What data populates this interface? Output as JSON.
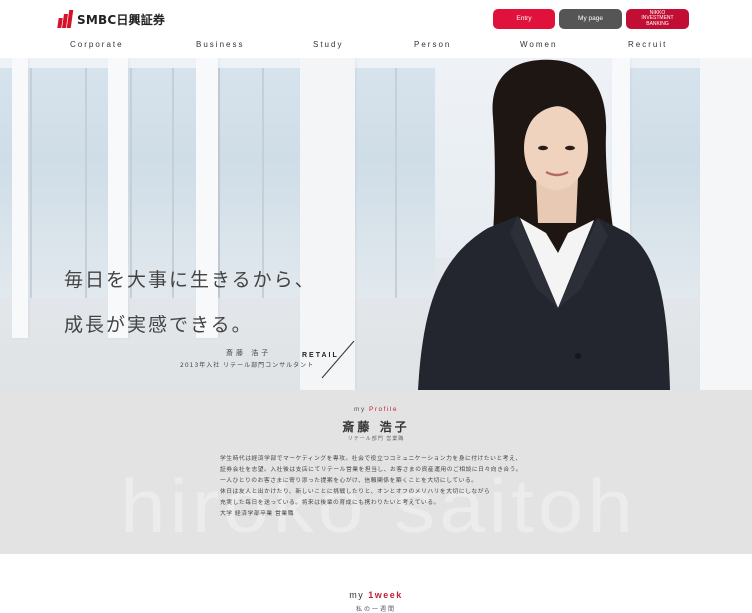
{
  "header": {
    "logo_text": "SMBC日興証券",
    "entry_label": "Entry",
    "mypage_label": "My page",
    "nikko_label": "NIKKO\nINVESTMENT\nBANKING"
  },
  "nav": [
    {
      "label": "Corporate"
    },
    {
      "label": "Business"
    },
    {
      "label": "Study"
    },
    {
      "label": "Person"
    },
    {
      "label": "Women"
    },
    {
      "label": "Recruit"
    }
  ],
  "hero": {
    "catch_line1": "毎日を大事に生きるから、",
    "catch_line2": "成長が実感できる。",
    "name": "斎藤 浩子",
    "year_line": "2013年入社 リテール部門コンサルタント",
    "retail_label": "RETAIL"
  },
  "profile": {
    "label_prefix": "my",
    "label_highlight": "Profile",
    "name": "斎藤 浩子",
    "ruby": "リテール部門 営業職",
    "watermark": "hiroko saitoh",
    "body_lines": [
      "学生時代は経済学部でマーケティングを専攻。社会で役立つコミュニケーション力を身に付けたいと考え、",
      "証券会社を志望。入社後は支店にてリテール営業を担当し、お客さまの資産運用のご相談に日々向き合う。",
      "一人ひとりのお客さまに寄り添った提案を心がけ、信頼関係を築くことを大切にしている。",
      "休日は友人と出かけたり、新しいことに挑戦したりと、オンとオフのメリハリを大切にしながら",
      "充実した毎日を送っている。将来は後輩の育成にも携わりたいと考えている。",
      "大学 経済学部卒業 営業職"
    ]
  },
  "week": {
    "title_prefix": "my",
    "title_highlight": "1week",
    "subtitle": "私の一週間"
  },
  "colors": {
    "brand_red": "#d6122a",
    "accent_pink": "#c61c3c",
    "profile_bg": "#e3e3e3"
  }
}
